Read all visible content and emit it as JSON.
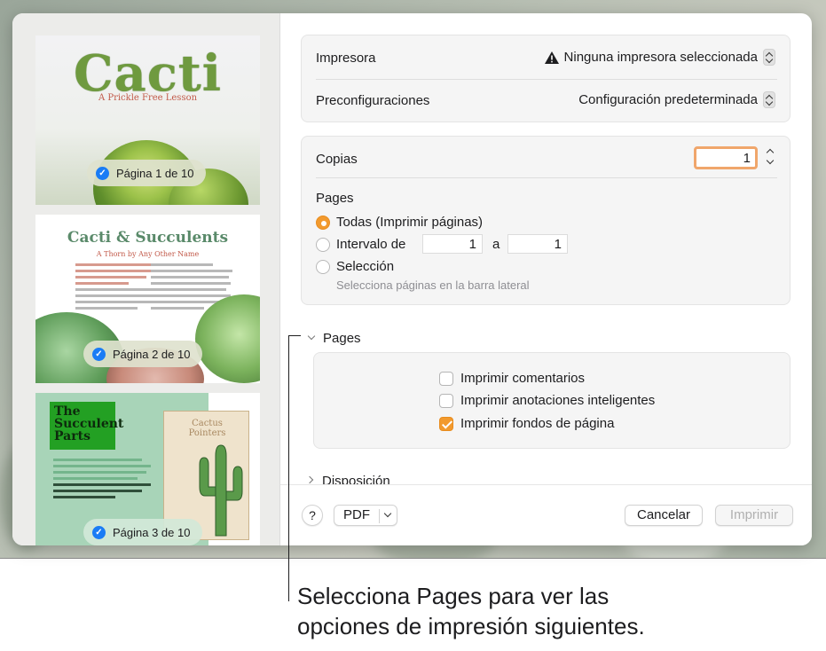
{
  "sidebar": {
    "thumbnails": [
      {
        "title": "Cacti",
        "subtitle": "A Prickle Free Lesson",
        "badge": "Página 1 de 10"
      },
      {
        "title": "Cacti & Succulents",
        "subtitle": "A Thorn by Any Other Name",
        "badge": "Página 2 de 10"
      },
      {
        "title_lines": [
          "The",
          "Succulent",
          "Parts"
        ],
        "poster_title": [
          "Cactus",
          "Pointers"
        ],
        "badge": "Página 3 de 10"
      }
    ]
  },
  "printer": {
    "label": "Impresora",
    "value": "Ninguna impresora seleccionada",
    "presets_label": "Preconfiguraciones",
    "presets_value": "Configuración predeterminada"
  },
  "copies": {
    "label": "Copias",
    "value": "1"
  },
  "pages": {
    "section_label": "Pages",
    "all_label": "Todas (Imprimir páginas)",
    "range_label": "Intervalo de",
    "range_from": "1",
    "range_sep": "a",
    "range_to": "1",
    "selection_label": "Selección",
    "selection_hint": "Selecciona páginas en la barra lateral",
    "selected": "all"
  },
  "app_options": {
    "header": "Pages",
    "options": [
      {
        "label": "Imprimir comentarios",
        "checked": false
      },
      {
        "label": "Imprimir anotaciones inteligentes",
        "checked": false
      },
      {
        "label": "Imprimir fondos de página",
        "checked": true
      }
    ]
  },
  "layout_section": {
    "header": "Disposición"
  },
  "footer": {
    "help": "?",
    "pdf": "PDF",
    "cancel": "Cancelar",
    "print": "Imprimir"
  },
  "callout": {
    "line1": "Selecciona Pages para ver las",
    "line2": "opciones de impresión siguientes."
  },
  "colors": {
    "accent": "#f29a2e",
    "check_blue": "#1a7cf5",
    "focus_ring": "#f0a66b"
  }
}
